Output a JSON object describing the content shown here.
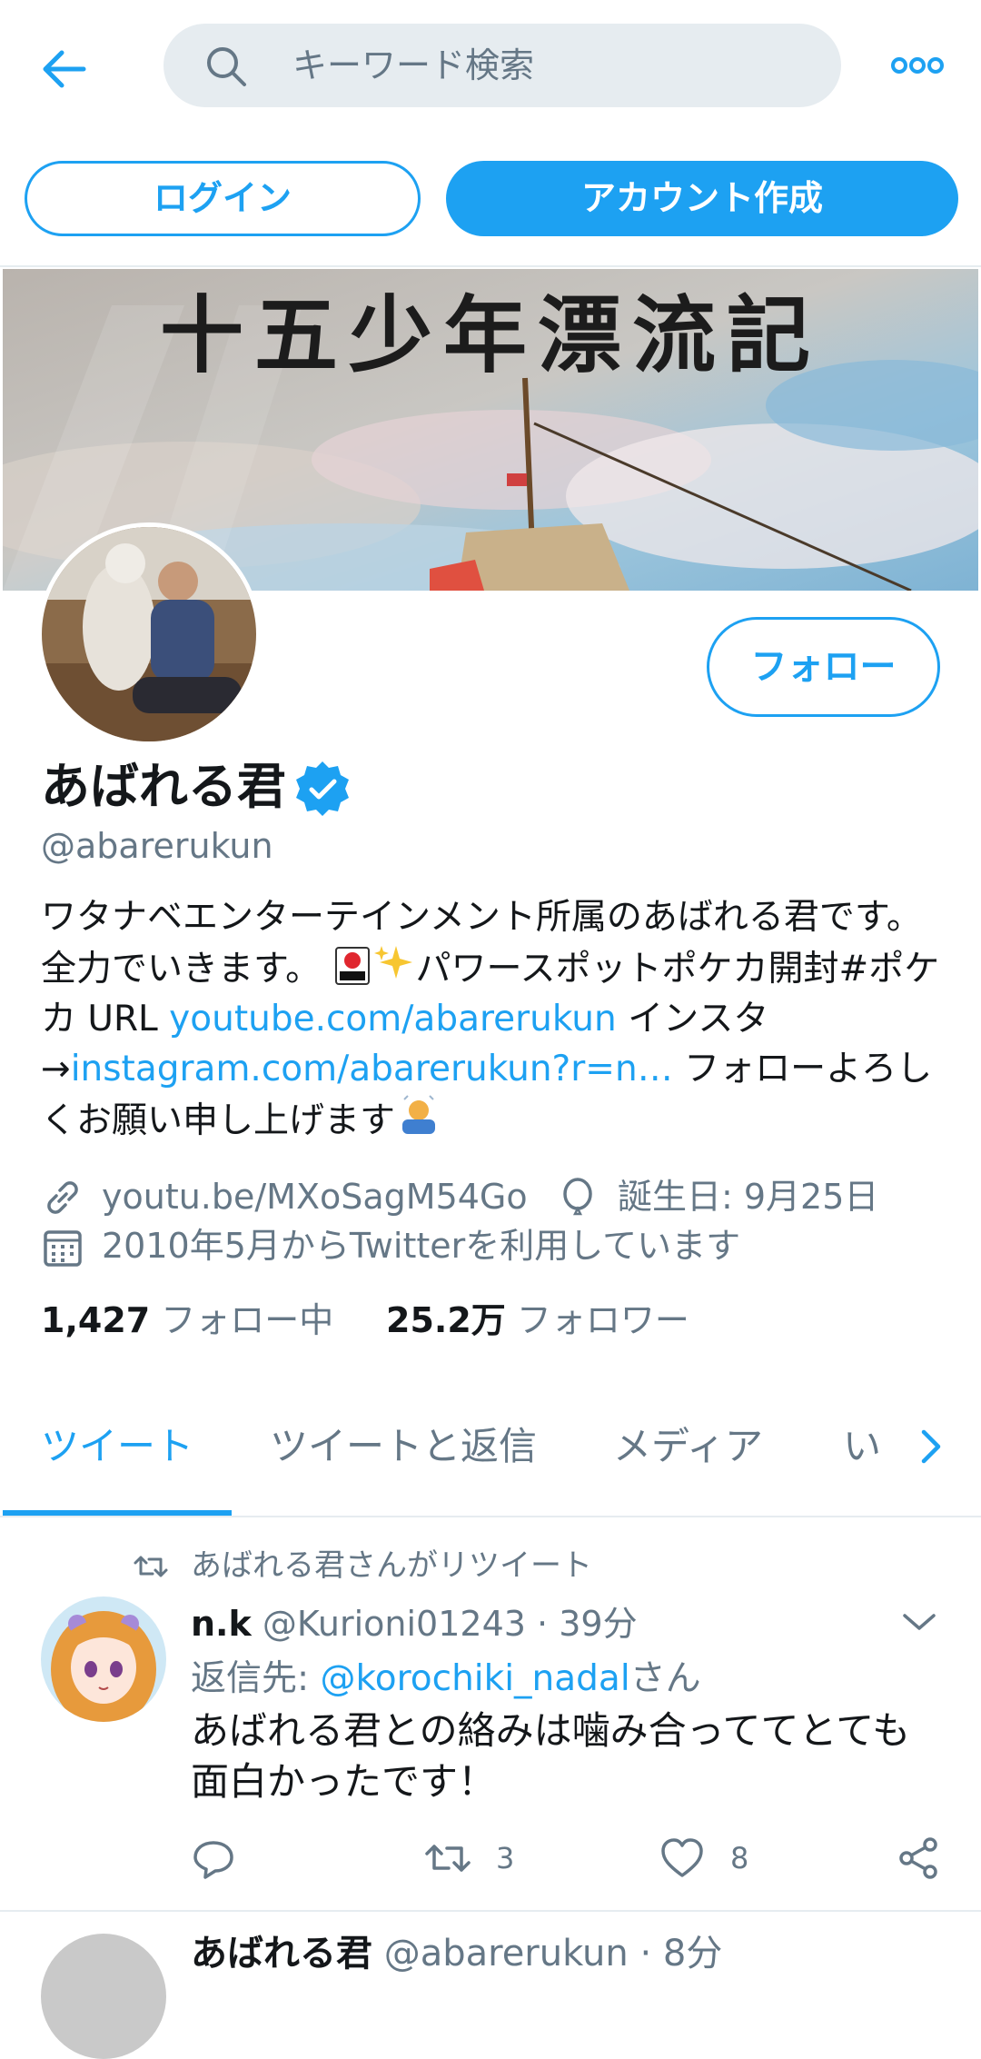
{
  "topbar": {
    "search_placeholder": "キーワード検索"
  },
  "auth": {
    "login_label": "ログイン",
    "signup_label": "アカウント作成"
  },
  "banner": {
    "title": "十五少年漂流記"
  },
  "profile": {
    "display_name": "あばれる君",
    "handle": "@abarerukun",
    "follow_label": "フォロー",
    "bio_1": "ワタナベエンターテインメント所属のあばれる君です。 全力でいきます。 ",
    "bio_2": "パワースポットポケカ開封#ポケカ URL ",
    "bio_link_1": "youtube.com/abarerukun",
    "bio_3": " インスタ→",
    "bio_link_2": "instagram.com/abarerukun?r=n…",
    "bio_4": " フォローよろしくお願い申し上げます",
    "website": "youtu.be/MXoSagM54Go",
    "birthday": "誕生日: 9月25日",
    "joined": "2010年5月からTwitterを利用しています",
    "following_count": "1,427",
    "following_label": "フォロー中",
    "followers_count": "25.2万",
    "followers_label": "フォロワー"
  },
  "tabs": [
    {
      "label": "ツイート"
    },
    {
      "label": "ツイートと返信"
    },
    {
      "label": "メディア"
    },
    {
      "label": "い"
    }
  ],
  "tweet": {
    "retweet_context": "あばれる君さんがリツイート",
    "author_name": "n.k",
    "author_handle": "@Kurioni01243",
    "time": "39分",
    "reply_prefix": "返信先: ",
    "reply_handle": "@korochiki_nadal",
    "reply_suffix": "さん",
    "text": "あばれる君との絡みは噛み合っててとても面白かったです！",
    "retweets": "3",
    "likes": "8"
  },
  "next_tweet": {
    "author_name": "あばれる君",
    "author_handle": "@abarerukun",
    "time": "8分"
  },
  "colors": {
    "accent": "#1da1f2",
    "secondary_text": "#657786",
    "divider": "#e6ecf0"
  }
}
